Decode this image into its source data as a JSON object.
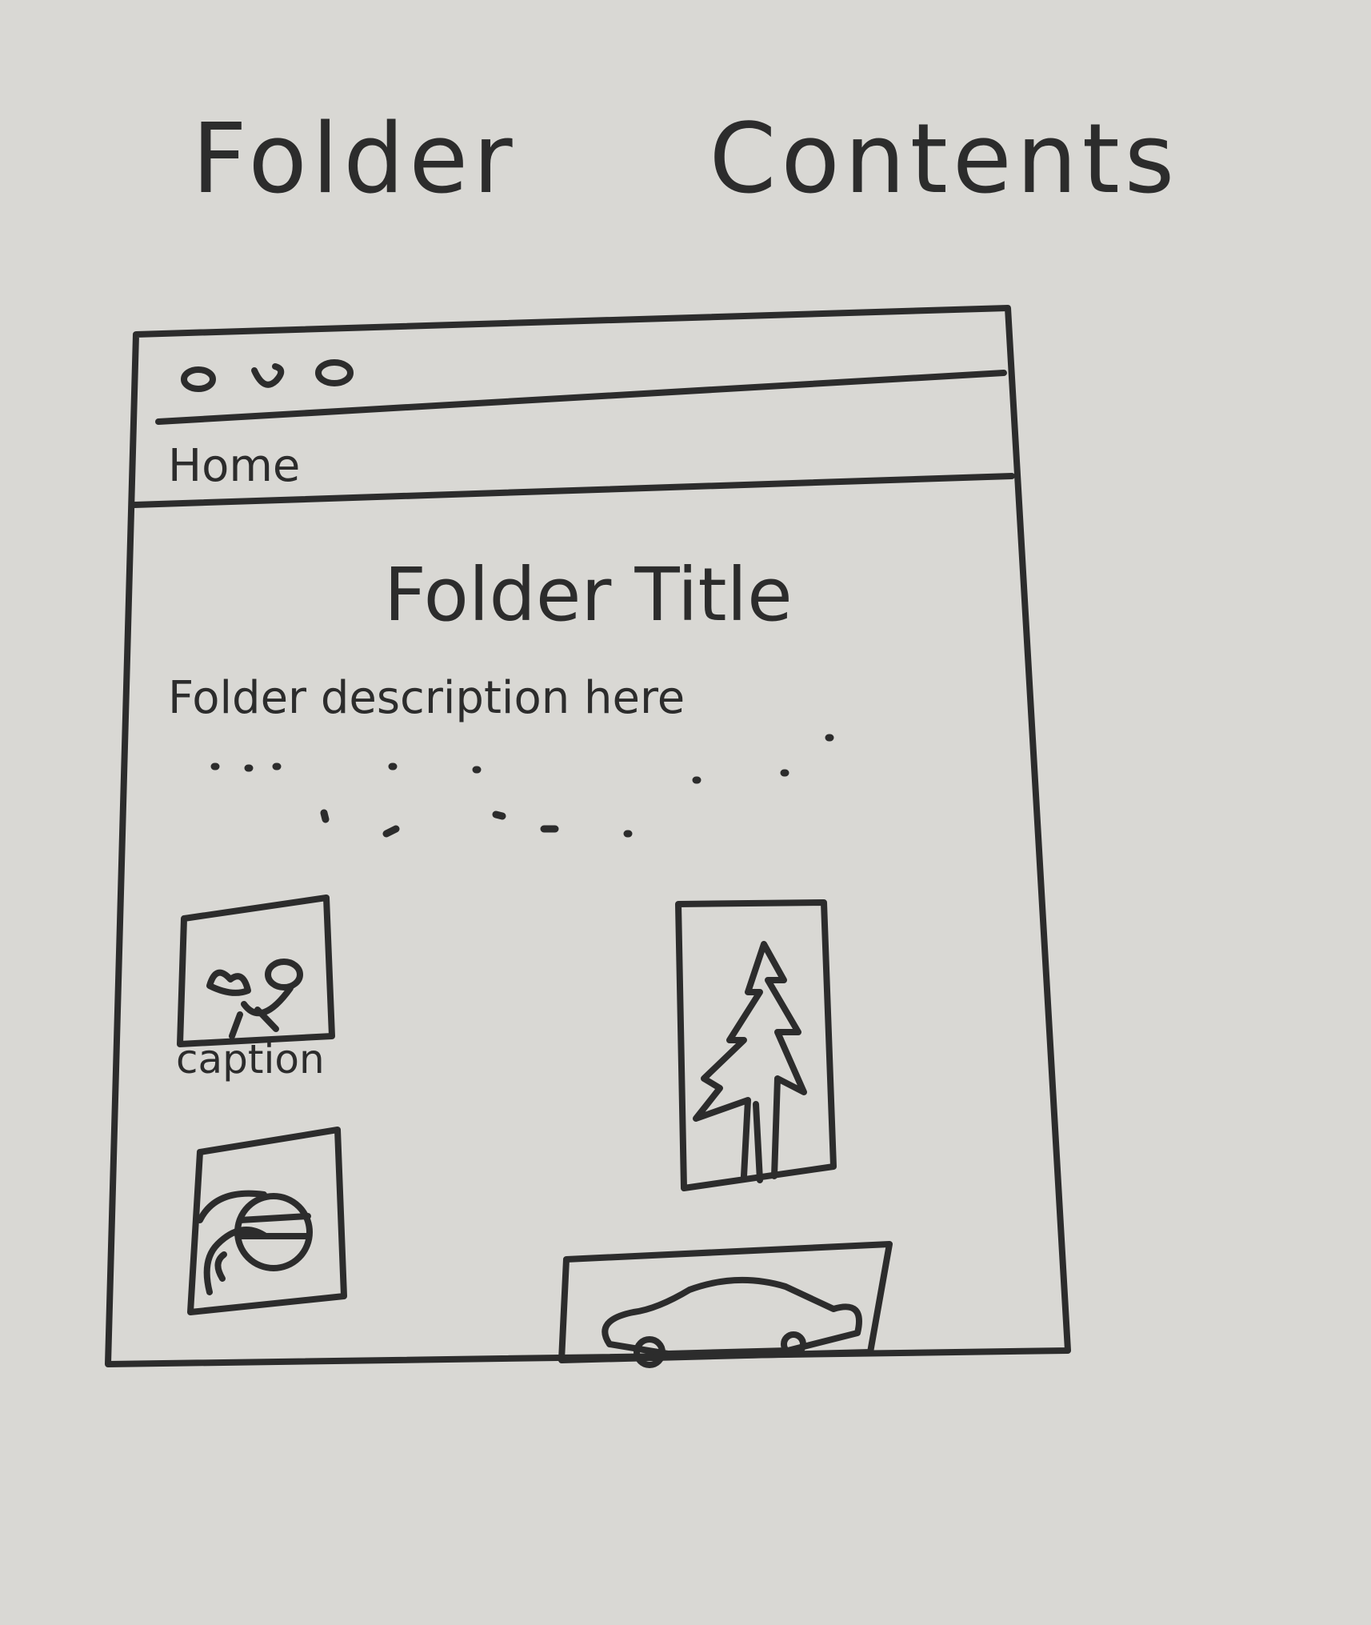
{
  "sketch_title": [
    "Folder",
    "Contents"
  ],
  "window": {
    "controls": [
      "circle",
      "circle",
      "circle"
    ]
  },
  "nav": {
    "home_label": "Home"
  },
  "folder": {
    "title": "Folder Title",
    "description": "Folder description here"
  },
  "gallery": {
    "items": [
      {
        "icon": "face-icon",
        "caption": "caption"
      },
      {
        "icon": "tree-icon"
      },
      {
        "icon": "hand-ball-icon"
      },
      {
        "icon": "car-icon"
      }
    ]
  }
}
